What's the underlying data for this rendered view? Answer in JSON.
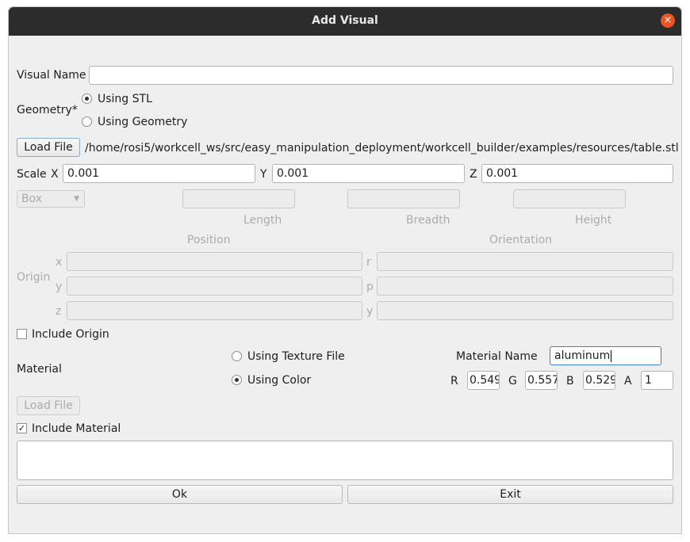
{
  "window": {
    "title": "Add Visual"
  },
  "visual_name": {
    "label": "Visual Name",
    "value": ""
  },
  "geometry": {
    "label": "Geometry*",
    "option_stl": "Using STL",
    "option_geometry": "Using Geometry",
    "selected": "Using STL"
  },
  "load_file": {
    "button": "Load File",
    "path": "/home/rosi5/workcell_ws/src/easy_manipulation_deployment/workcell_builder/examples/resources/table.stl"
  },
  "scale": {
    "label": "Scale",
    "x_label": "X",
    "x": "0.001",
    "y_label": "Y",
    "y": "0.001",
    "z_label": "Z",
    "z": "0.001"
  },
  "shape": {
    "selected": "Box",
    "length": "Length",
    "breadth": "Breadth",
    "height": "Height"
  },
  "origin": {
    "label": "Origin",
    "position": "Position",
    "orientation": "Orientation",
    "x": "x",
    "y": "y",
    "z": "z",
    "r": "r",
    "p": "p",
    "yaw": "y",
    "include_label": "Include Origin",
    "include_checked": false
  },
  "material": {
    "label": "Material",
    "option_texture": "Using Texture File",
    "option_color": "Using Color",
    "selected": "Using Color",
    "name_label": "Material Name",
    "name_value": "aluminum",
    "r_label": "R",
    "r": "0.549",
    "g_label": "G",
    "g": "0.557",
    "b_label": "B",
    "b": "0.529",
    "a_label": "A",
    "a": "1",
    "load_file": "Load File",
    "include_label": "Include Material",
    "include_checked": true,
    "check_glyph": "✓"
  },
  "buttons": {
    "ok": "Ok",
    "exit": "Exit"
  },
  "icons": {
    "close": "×",
    "dropdown": "▼"
  }
}
